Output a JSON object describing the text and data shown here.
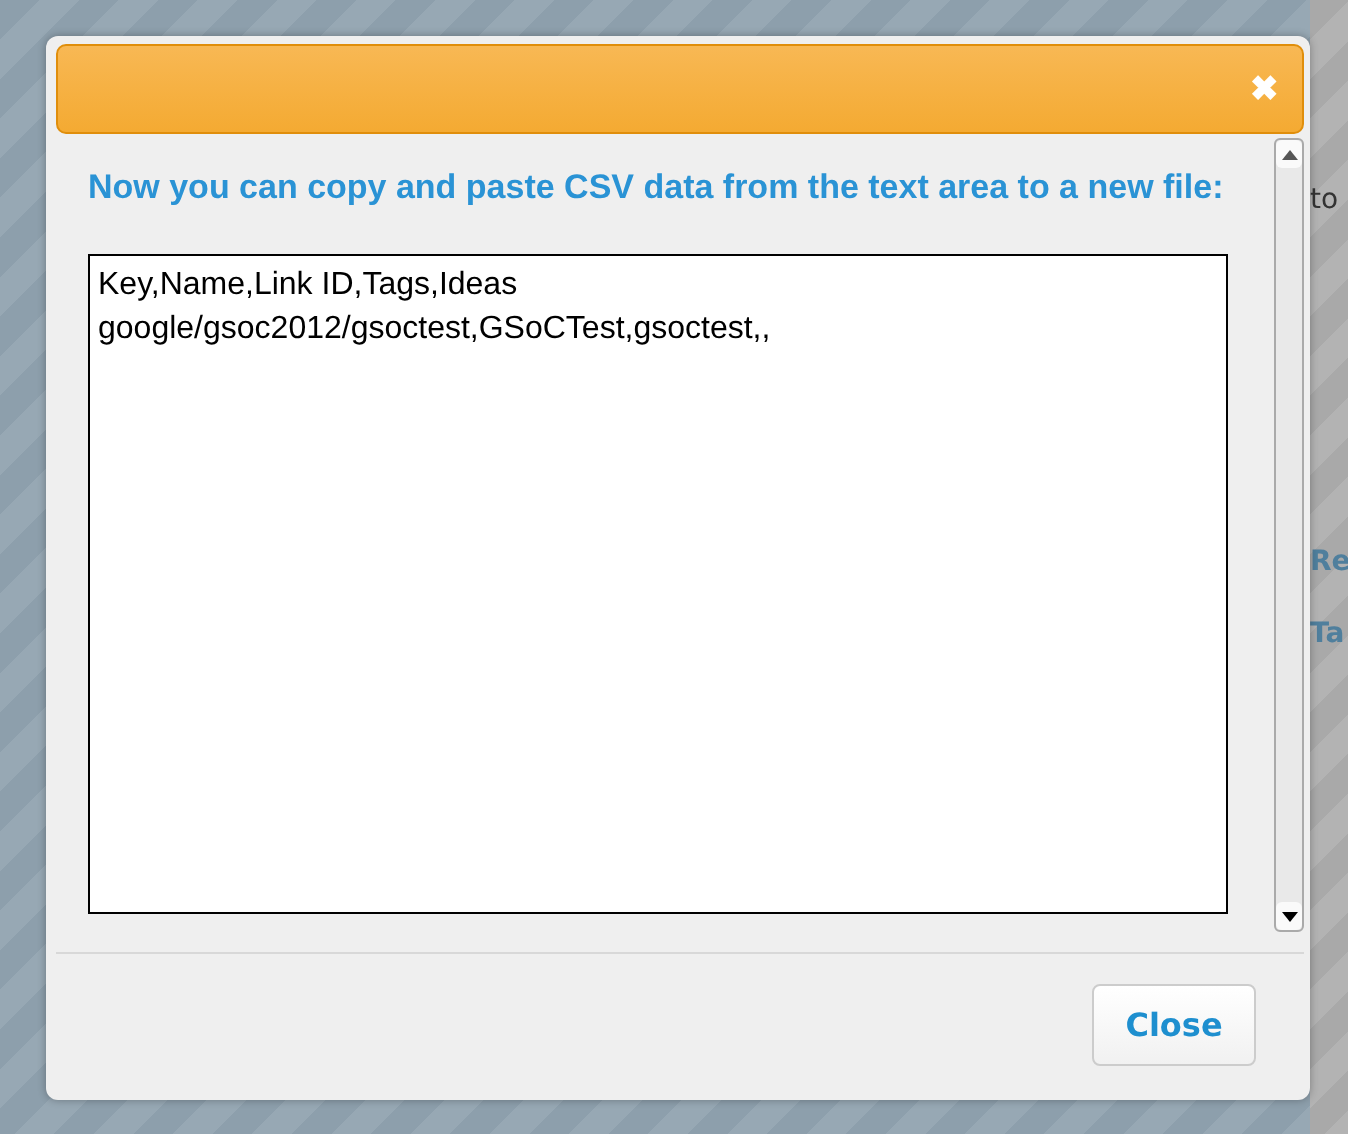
{
  "background": {
    "fragments": [
      "to",
      "Re",
      "Ta"
    ]
  },
  "dialog": {
    "close_glyph": "✖",
    "message": "Now you can copy and paste CSV data from the text area to a new file:",
    "csv_lines": [
      "Key,Name,Link ID,Tags,Ideas",
      "google/gsoc2012/gsoctest,GSoCTest,gsoctest,,"
    ],
    "buttons": [
      "Close"
    ]
  }
}
